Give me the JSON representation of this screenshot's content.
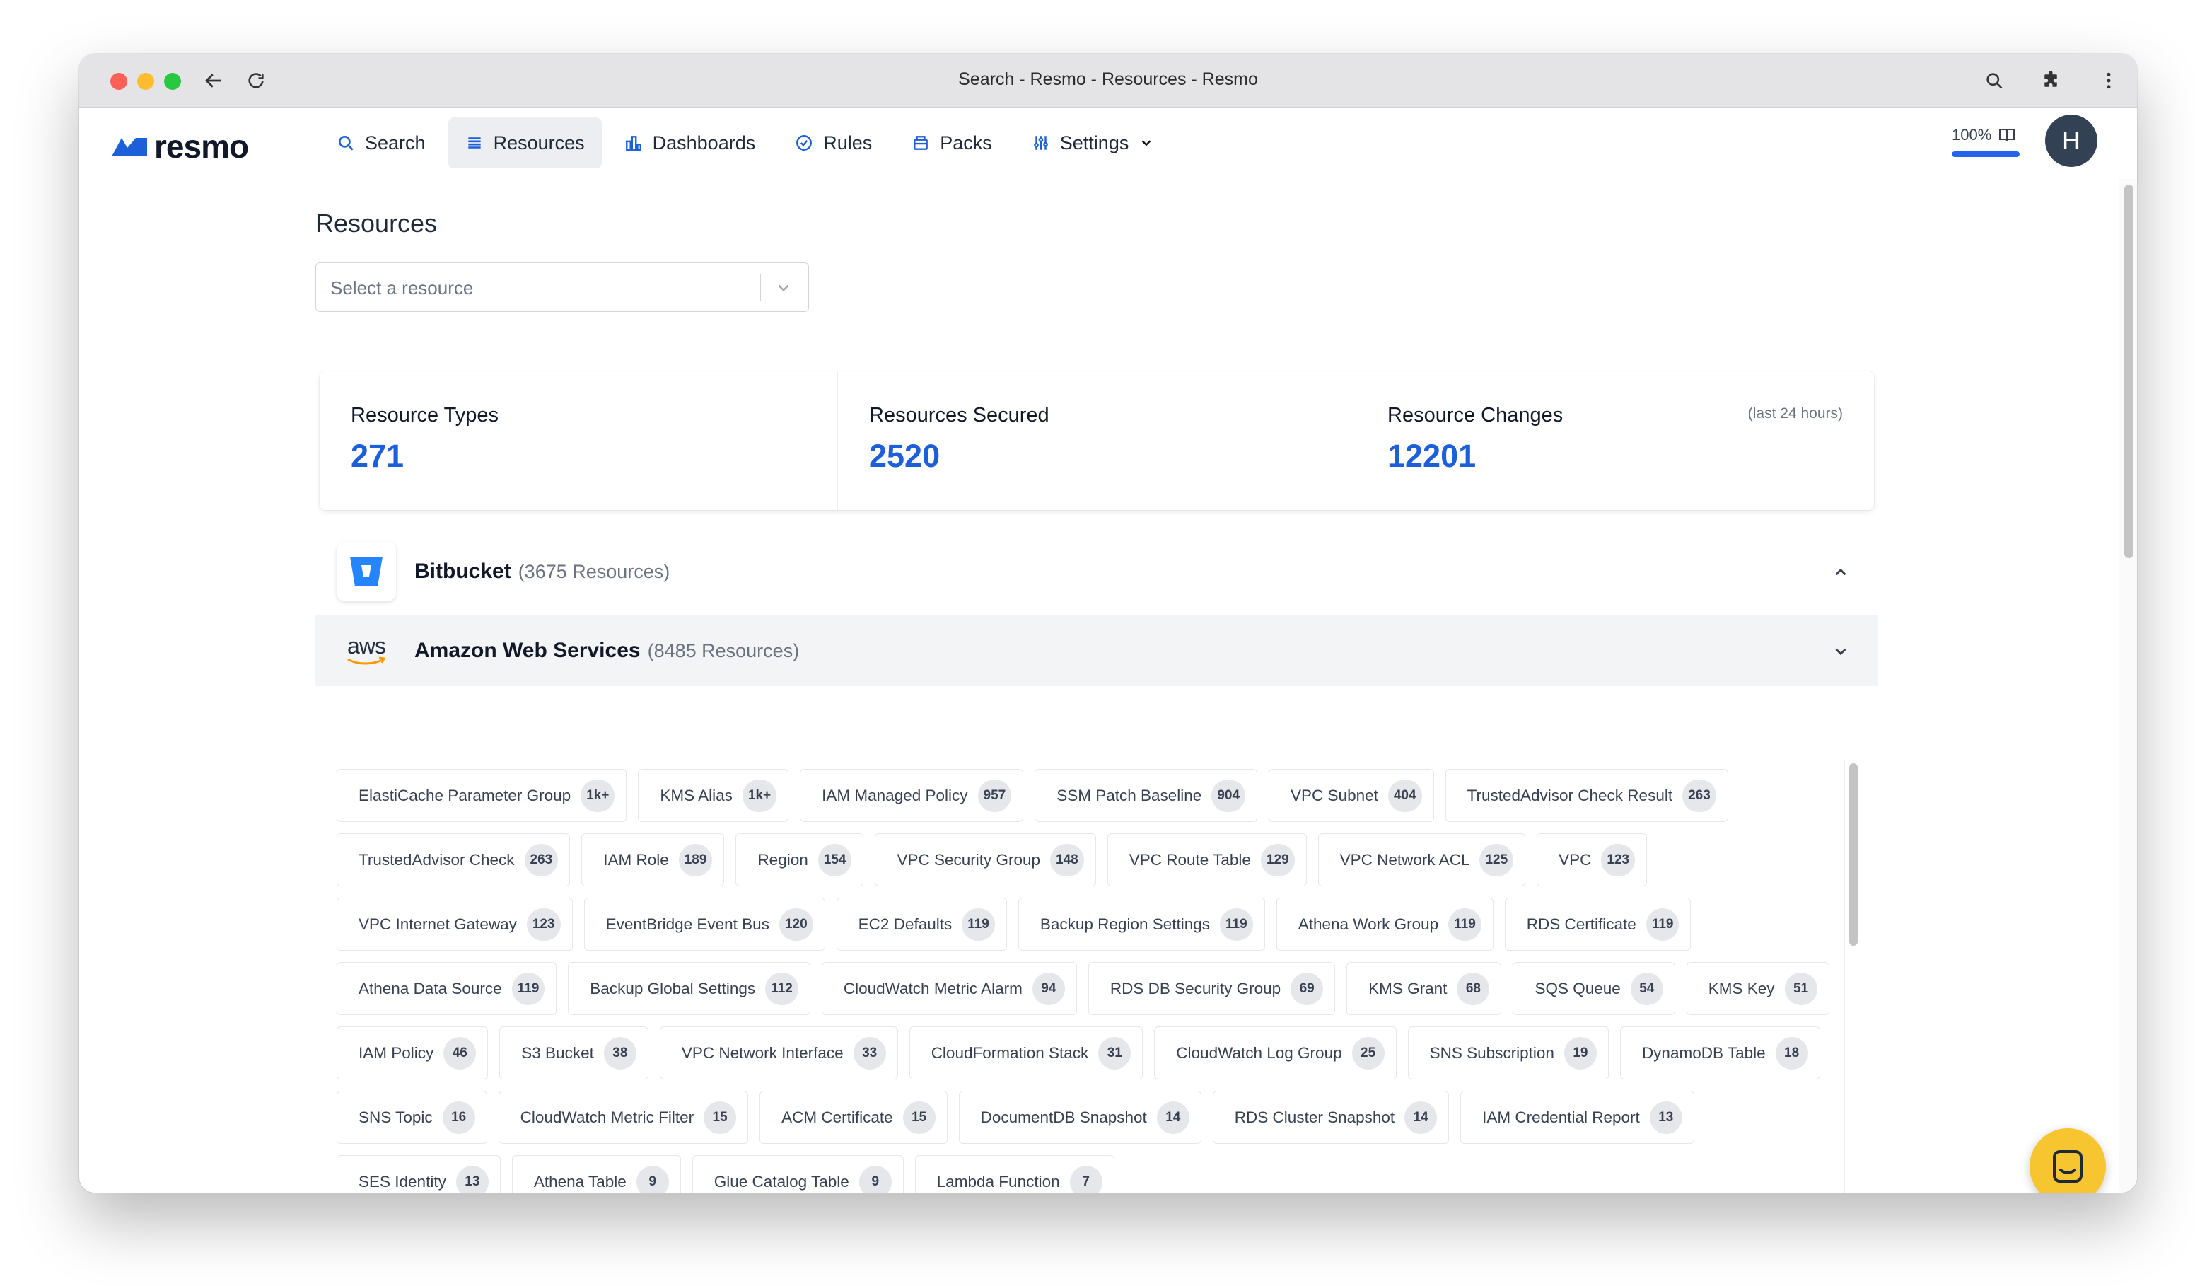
{
  "browser": {
    "title": "Search - Resmo - Resources - Resmo"
  },
  "brand": {
    "name": "resmo",
    "accent": "#1d5fd8"
  },
  "nav": {
    "items": [
      {
        "label": "Search",
        "icon": "search-icon"
      },
      {
        "label": "Resources",
        "icon": "list-icon",
        "active": true
      },
      {
        "label": "Dashboards",
        "icon": "bar-chart-icon"
      },
      {
        "label": "Rules",
        "icon": "check-circle-icon"
      },
      {
        "label": "Packs",
        "icon": "package-icon"
      },
      {
        "label": "Settings",
        "icon": "sliders-icon"
      }
    ],
    "zoom": "100%",
    "zoom_progress": 1.0,
    "avatar_initial": "H"
  },
  "page": {
    "title": "Resources",
    "select_placeholder": "Select a resource"
  },
  "stats": [
    {
      "label": "Resource Types",
      "value": "271",
      "note": ""
    },
    {
      "label": "Resources Secured",
      "value": "2520",
      "note": ""
    },
    {
      "label": "Resource Changes",
      "value": "12201",
      "note": "(last 24 hours)"
    }
  ],
  "providers": [
    {
      "name": "Bitbucket",
      "count": "(3675 Resources)",
      "icon": "bitbucket-icon",
      "expanded": false
    },
    {
      "name": "Amazon Web Services",
      "count": "(8485 Resources)",
      "icon": "aws-icon",
      "expanded": true
    }
  ],
  "aws_resources": [
    {
      "label": "ElastiCache Parameter Group",
      "count": "1k+"
    },
    {
      "label": "KMS Alias",
      "count": "1k+"
    },
    {
      "label": "IAM Managed Policy",
      "count": "957"
    },
    {
      "label": "SSM Patch Baseline",
      "count": "904"
    },
    {
      "label": "VPC Subnet",
      "count": "404"
    },
    {
      "label": "TrustedAdvisor Check Result",
      "count": "263"
    },
    {
      "label": "TrustedAdvisor Check",
      "count": "263"
    },
    {
      "label": "IAM Role",
      "count": "189"
    },
    {
      "label": "Region",
      "count": "154"
    },
    {
      "label": "VPC Security Group",
      "count": "148"
    },
    {
      "label": "VPC Route Table",
      "count": "129"
    },
    {
      "label": "VPC Network ACL",
      "count": "125"
    },
    {
      "label": "VPC",
      "count": "123"
    },
    {
      "label": "VPC Internet Gateway",
      "count": "123"
    },
    {
      "label": "EventBridge Event Bus",
      "count": "120"
    },
    {
      "label": "EC2 Defaults",
      "count": "119"
    },
    {
      "label": "Backup Region Settings",
      "count": "119"
    },
    {
      "label": "Athena Work Group",
      "count": "119"
    },
    {
      "label": "RDS Certificate",
      "count": "119"
    },
    {
      "label": "Athena Data Source",
      "count": "119"
    },
    {
      "label": "Backup Global Settings",
      "count": "112"
    },
    {
      "label": "CloudWatch Metric Alarm",
      "count": "94"
    },
    {
      "label": "RDS DB Security Group",
      "count": "69"
    },
    {
      "label": "KMS Grant",
      "count": "68"
    },
    {
      "label": "SQS Queue",
      "count": "54"
    },
    {
      "label": "KMS Key",
      "count": "51"
    },
    {
      "label": "IAM Policy",
      "count": "46"
    },
    {
      "label": "S3 Bucket",
      "count": "38"
    },
    {
      "label": "VPC Network Interface",
      "count": "33"
    },
    {
      "label": "CloudFormation Stack",
      "count": "31"
    },
    {
      "label": "CloudWatch Log Group",
      "count": "25"
    },
    {
      "label": "SNS Subscription",
      "count": "19"
    },
    {
      "label": "DynamoDB Table",
      "count": "18"
    },
    {
      "label": "SNS Topic",
      "count": "16"
    },
    {
      "label": "CloudWatch Metric Filter",
      "count": "15"
    },
    {
      "label": "ACM Certificate",
      "count": "15"
    },
    {
      "label": "DocumentDB Snapshot",
      "count": "14"
    },
    {
      "label": "RDS Cluster Snapshot",
      "count": "14"
    },
    {
      "label": "IAM Credential Report",
      "count": "13"
    },
    {
      "label": "SES Identity",
      "count": "13"
    },
    {
      "label": "Athena Table",
      "count": "9"
    },
    {
      "label": "Glue Catalog Table",
      "count": "9"
    },
    {
      "label": "Lambda Function",
      "count": "7"
    }
  ]
}
